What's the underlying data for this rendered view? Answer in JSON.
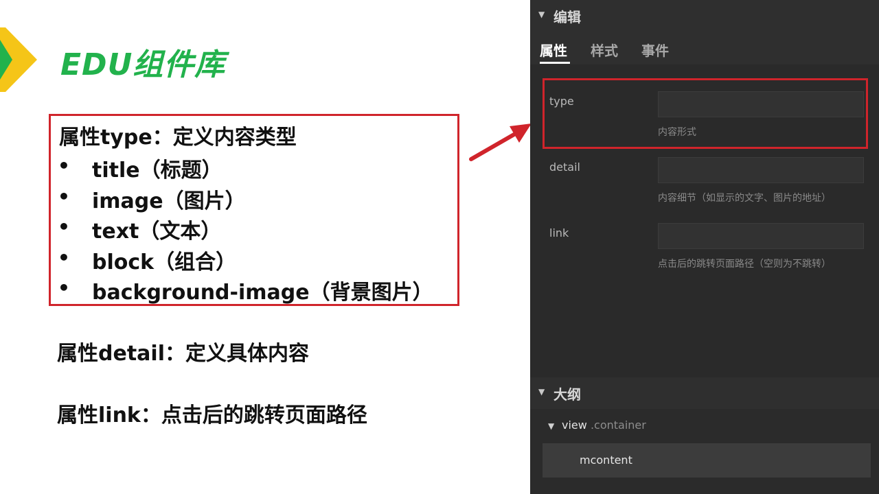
{
  "slide": {
    "title": "EDU组件库",
    "type_heading": "属性type：定义内容类型",
    "type_items": [
      "title（标题）",
      "image（图片）",
      "text（文本）",
      "block（组合）",
      "background-image（背景图片）"
    ],
    "bullet_symbol": "•",
    "detail_line": "属性detail：定义具体内容",
    "link_line": "属性link：点击后的跳转页面路径"
  },
  "panel": {
    "edit_section": "编辑",
    "tabs": [
      "属性",
      "样式",
      "事件"
    ],
    "active_tab": "属性",
    "fields": [
      {
        "label": "type",
        "value": "",
        "hint": "内容形式"
      },
      {
        "label": "detail",
        "value": "",
        "hint": "内容细节（如显示的文字、图片的地址）"
      },
      {
        "label": "link",
        "value": "",
        "hint": "点击后的跳转页面路径（空则为不跳转）"
      }
    ],
    "outline_section": "大纲",
    "outline": {
      "root_name": "view",
      "root_class": ".container",
      "child_name": "mcontent"
    }
  },
  "icons": {
    "slide_marker": "chevron-arrow-icon",
    "collapse_caret": "caret-down-icon",
    "pointer_arrow": "red-arrow-icon"
  },
  "colors": {
    "title_green": "#22b24c",
    "highlight_red": "#d0242b",
    "chevron_yellow": "#f5c518",
    "panel_bg": "#2b2b2b"
  }
}
